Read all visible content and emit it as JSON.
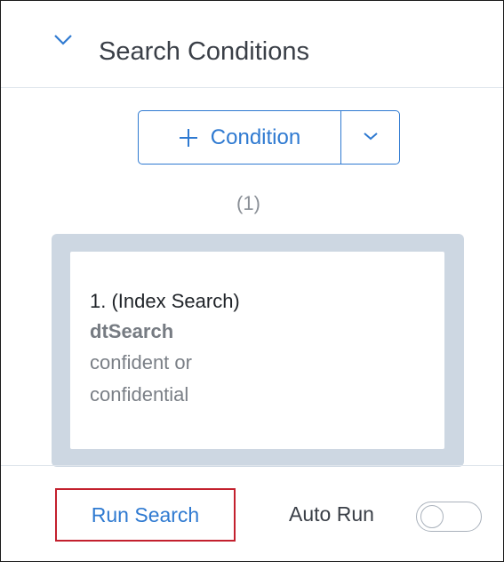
{
  "header": {
    "title": "Search Conditions",
    "collapse_icon": "chevron-down-icon"
  },
  "add_condition": {
    "label": "Condition",
    "icon": "plus-icon",
    "dropdown_icon": "chevron-down-icon"
  },
  "conditions_count": "(1)",
  "conditions": [
    {
      "title": "1. (Index Search)",
      "type": "dtSearch",
      "terms": "confident or confidential"
    }
  ],
  "footer": {
    "run_label": "Run Search",
    "auto_run_label": "Auto Run",
    "auto_run_enabled": false
  },
  "colors": {
    "accent": "#2f7ad1",
    "highlight_border": "#c3202e",
    "card_background": "#cdd7e2"
  }
}
